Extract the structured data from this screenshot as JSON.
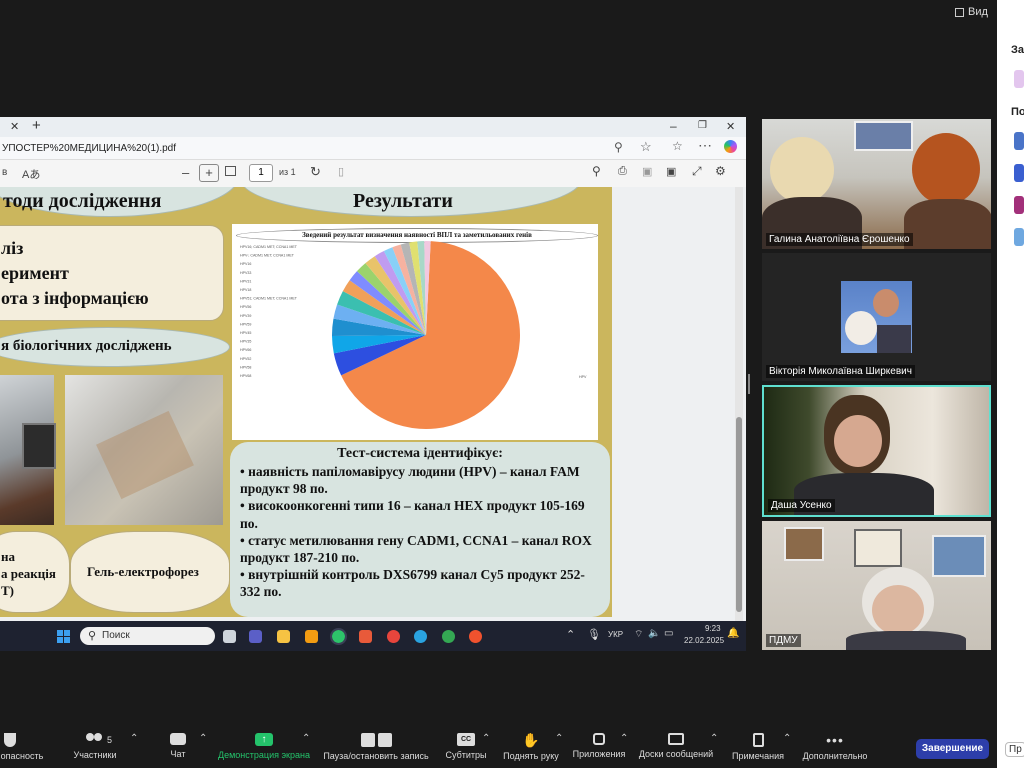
{
  "top": {
    "view_label": "Вид"
  },
  "side": {
    "header_top": "За",
    "header_mid": "По",
    "bottom_btn": "Пр"
  },
  "browser": {
    "url": "УПОСТЕР%20МЕДИЦИНА%20(1).pdf",
    "page_input": "1",
    "page_total": "из 1"
  },
  "poster": {
    "methods_title": "тоди дослідження",
    "methods_list": [
      "ліз",
      "еримент",
      "ота з інформацією"
    ],
    "bio_title": "я біологічних досліджень",
    "label_pcr": "на\nа реакція\nТ)",
    "label_gel": "Гель-електрофорез",
    "results_title": "Результати",
    "chart_title": "Зведений результат визначення наявності ВПЛ та заметильованих генів",
    "test_title": "Тест-система ідентифікує:",
    "test_lines": [
      "• наявність папіломавірусу людини (HPV) – канал FAM продукт 98 по.",
      "• високоонкогенні  типи 16 – канал HEX продукт 105-169 по.",
      "• статус метилювання гену CADM1, CCNA1 – канал ROX продукт 187-210 по.",
      "• внутрішній контроль DXS6799  канал Cy5 продукт 252-332 по."
    ]
  },
  "chart_data": {
    "type": "pie",
    "title": "Зведений результат визначення наявності ВПЛ та заметильованих генів",
    "labels": [
      "HPV",
      "HPV16; CADM1 MET; CCNA1 MET",
      "HPV-; CADM1 MET; CCNA1 MET",
      "HPV16",
      "HPV33",
      "HPV31",
      "HPV18",
      "HPV51; CADM1 MET; CCNA1 MET",
      "HPV56",
      "HPV39",
      "HPV59",
      "HPV45",
      "HPV35",
      "HPV66",
      "HPV52",
      "HPV58",
      "HPV68"
    ],
    "values": [
      68,
      4,
      3,
      3,
      2.5,
      2.5,
      2.2,
      2,
      2,
      2,
      1.8,
      1.6,
      1.5,
      1.5,
      1.4,
      1.2,
      1.1
    ],
    "colors": [
      "#f4884a",
      "#2d4fe0",
      "#10a6e8",
      "#1f8fcf",
      "#6db0f2",
      "#3bbfb0",
      "#f0a05a",
      "#7f8cff",
      "#9bd36c",
      "#e8c36a",
      "#c09cf0",
      "#88d0f7",
      "#f6b2a0",
      "#b5b5b5",
      "#e0e070",
      "#a8d8c8",
      "#f2c8e0"
    ]
  },
  "taskbar": {
    "search_placeholder": "Поиск",
    "lang": "УКР",
    "time": "9:23",
    "date": "22.02.2025"
  },
  "participants": [
    {
      "name": "Галина Анатоліївна Єрошенко"
    },
    {
      "name": "Вікторія Миколаївна Ширкевич"
    },
    {
      "name": "Даша Усенко"
    },
    {
      "name": "ПДМУ"
    }
  ],
  "toolbar": {
    "security": "опасность",
    "participants": "Участники",
    "participants_count": "5",
    "chat": "Чат",
    "share": "Демонстрация экрана",
    "record": "Пауза/остановить запись",
    "captions": "Субтитры",
    "raise_hand": "Поднять руку",
    "apps": "Приложения",
    "whiteboards": "Доски сообщений",
    "notes": "Примечания",
    "more": "Дополнительно",
    "end": "Завершение"
  },
  "colors": {
    "accent": "#2d3eaa",
    "share_green": "#24c36b",
    "poster_bg": "#cbb65d"
  }
}
